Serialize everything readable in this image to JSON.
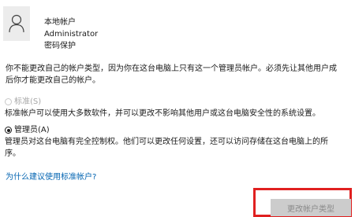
{
  "account": {
    "type": "本地帐户",
    "name": "Administrator",
    "password_status": "密码保护"
  },
  "warning_lines": [
    "你不能更改自己的帐户类型，因为你在这台电脑上只有这一个管理员帐户。必须先让其他用户成",
    "后你才能更改自己的帐户。"
  ],
  "options": {
    "standard": {
      "label": "标准(S)",
      "description": "标准帐户可以使用大多数软件，并可以更改不影响其他用户或这台电脑安全性的系统设置。",
      "state": "disabled"
    },
    "admin": {
      "label": "管理员(A)",
      "description_lines": [
        "管理员对这台电脑有完全控制权。他们可以更改任何设置，还可以访问存储在这台电脑上的所",
        "序。"
      ],
      "state": "selected"
    }
  },
  "why_link": "为什么建议使用标准帐户?",
  "change_button": "更改帐户类型",
  "colors": {
    "link": "#0063b1",
    "highlight": "#e02020",
    "button_disabled": "#cccccc"
  }
}
